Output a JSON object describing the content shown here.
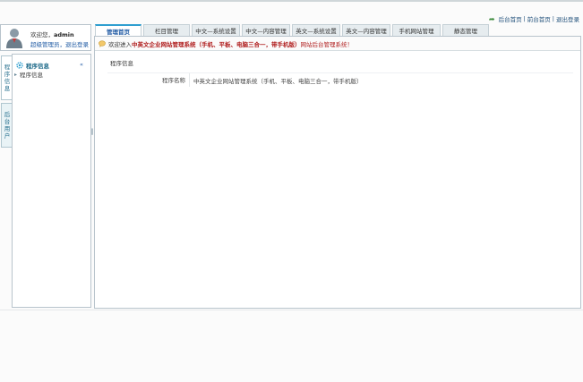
{
  "header": {
    "links": [
      "后台首页",
      "前台首页",
      "退出登录"
    ],
    "separator": "|"
  },
  "user": {
    "welcome_prefix": "欢迎您，",
    "username": "admin",
    "role": "超级管理员",
    "sep": "，",
    "logout": "退出登录"
  },
  "sidebar_tabs": [
    {
      "label": [
        "程",
        "序",
        "信",
        "息"
      ]
    },
    {
      "label": [
        "后",
        "台",
        "用",
        "户"
      ]
    }
  ],
  "left_panel": {
    "heading": "程序信息",
    "collapse": "«",
    "items": [
      {
        "label": "程序信息"
      }
    ]
  },
  "tabs": [
    {
      "label": "管理首页",
      "active": true
    },
    {
      "label": "栏目管理"
    },
    {
      "label": "中文—系统设置"
    },
    {
      "label": "中文—内容管理"
    },
    {
      "label": "英文—系统设置"
    },
    {
      "label": "英文—内容管理"
    },
    {
      "label": "手机网站管理"
    },
    {
      "label": "静态管理"
    }
  ],
  "notice": {
    "prefix": "欢迎进入",
    "system": "中英文企业网站管理系统（手机、平板、电脑三合一，带手机版）",
    "suffix": "网站后台管理系统！"
  },
  "info": {
    "title": "程序信息",
    "rows": [
      {
        "key": "程序名称",
        "value": "中英文企业网站管理系统（手机、平板、电脑三合一，带手机版）"
      }
    ]
  },
  "colors": {
    "accent": "#2f9fd0",
    "link": "#1f5aa3",
    "highlight": "#b01e1e"
  }
}
